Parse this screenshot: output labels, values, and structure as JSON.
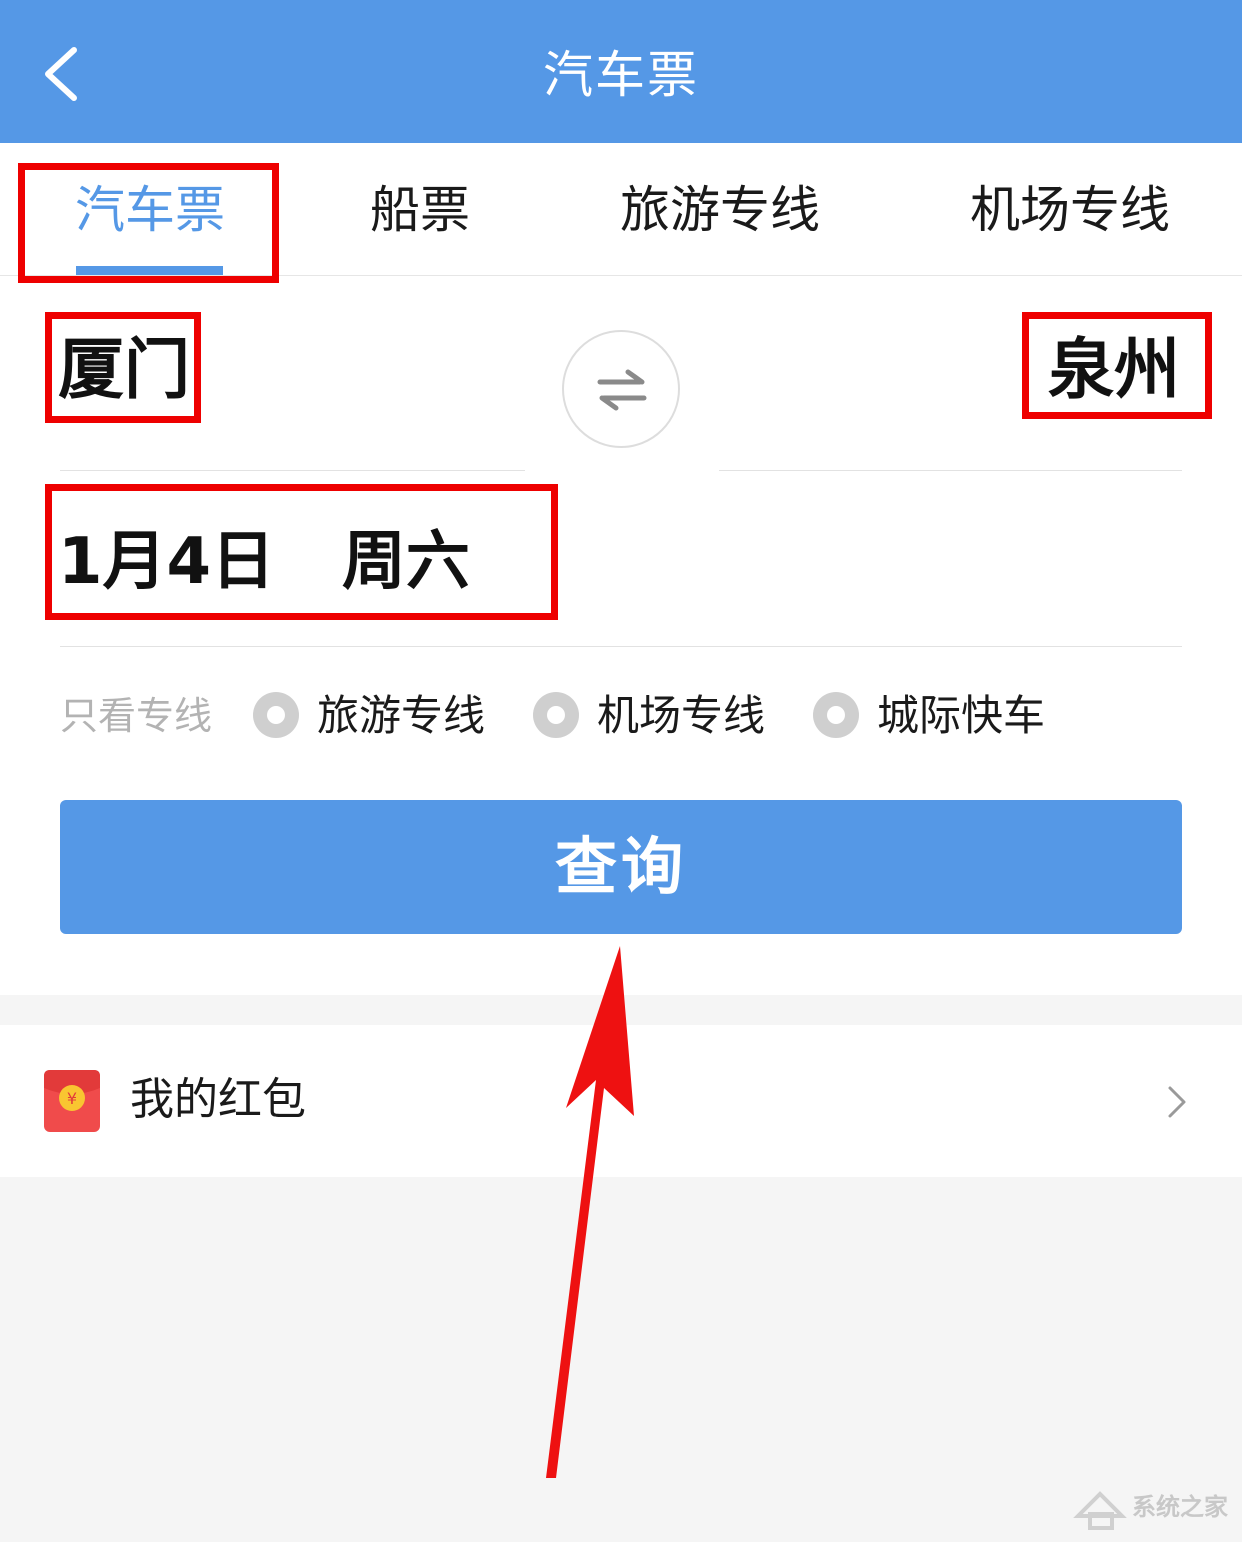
{
  "header": {
    "title": "汽车票",
    "back_icon": "chevron-left-icon"
  },
  "tabs": [
    {
      "label": "汽车票",
      "active": true
    },
    {
      "label": "船票",
      "active": false
    },
    {
      "label": "旅游专线",
      "active": false
    },
    {
      "label": "机场专线",
      "active": false
    }
  ],
  "route": {
    "from_city": "厦门",
    "to_city": "泉州",
    "swap_icon": "swap-arrows-icon"
  },
  "date": {
    "text": "1月4日   周六"
  },
  "filter": {
    "label": "只看专线",
    "options": [
      {
        "label": "旅游专线",
        "selected": false
      },
      {
        "label": "机场专线",
        "selected": false
      },
      {
        "label": "城际快车",
        "selected": false
      }
    ]
  },
  "search": {
    "label": "查询"
  },
  "red_packet": {
    "label": "我的红包",
    "icon": "red-packet-icon",
    "chevron": "chevron-right-icon"
  },
  "watermark": {
    "text": "系统之家"
  },
  "colors": {
    "primary": "#5598e6",
    "annotation": "#ee0000",
    "background": "#f5f5f5"
  }
}
